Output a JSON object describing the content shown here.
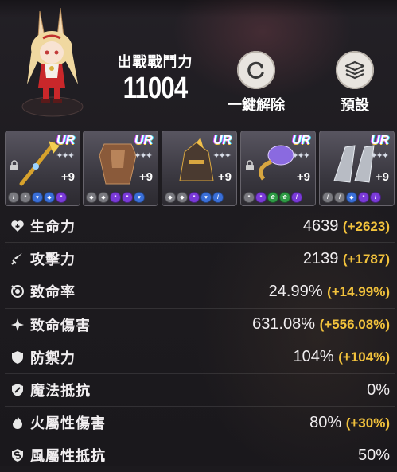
{
  "header": {
    "power_label": "出戰戰鬥力",
    "power_value": "11004",
    "reset_label": "一鍵解除",
    "preset_label": "預設"
  },
  "equipment": [
    {
      "rarity": "UR",
      "level": "+9",
      "locked": true
    },
    {
      "rarity": "UR",
      "level": "+9",
      "locked": false
    },
    {
      "rarity": "UR",
      "level": "+9",
      "locked": false
    },
    {
      "rarity": "UR",
      "level": "+9",
      "locked": true
    },
    {
      "rarity": "UR",
      "level": "+9",
      "locked": false
    }
  ],
  "stats": [
    {
      "name": "生命力",
      "value": "4639",
      "bonus": "(+2623)",
      "icon": "heart-plus-icon"
    },
    {
      "name": "攻擊力",
      "value": "2139",
      "bonus": "(+1787)",
      "icon": "sword-icon"
    },
    {
      "name": "致命率",
      "value": "24.99%",
      "bonus": "(+14.99%)",
      "icon": "critical-rate-icon"
    },
    {
      "name": "致命傷害",
      "value": "631.08%",
      "bonus": "(+556.08%)",
      "icon": "critical-damage-icon"
    },
    {
      "name": "防禦力",
      "value": "104%",
      "bonus": "(+104%)",
      "icon": "shield-icon"
    },
    {
      "name": "魔法抵抗",
      "value": "0%",
      "bonus": "",
      "icon": "magic-shield-icon"
    },
    {
      "name": "火屬性傷害",
      "value": "80%",
      "bonus": "(+30%)",
      "icon": "fire-icon"
    },
    {
      "name": "風屬性抵抗",
      "value": "50%",
      "bonus": "",
      "icon": "wind-shield-icon"
    }
  ],
  "colors": {
    "bonus": "#f2c23c",
    "background": "#1c1a1e"
  }
}
